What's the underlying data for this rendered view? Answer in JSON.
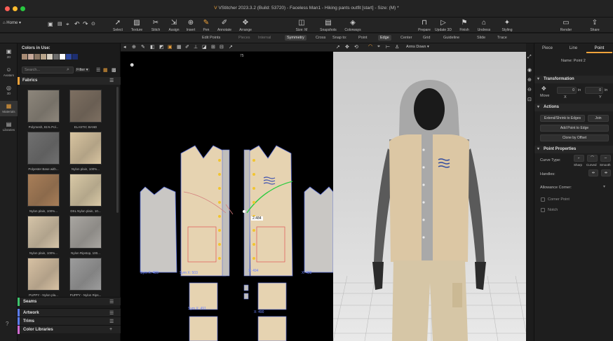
{
  "window": {
    "title": "VStitcher 2023.3.2 (Build: 53720) - Faceless Man1 - Hiking pants outfit [start] - Size: (M) *"
  },
  "nav": {
    "home_label": "Home"
  },
  "toolbar": {
    "tools": [
      {
        "label": "Select",
        "icon": "cursor-icon"
      },
      {
        "label": "Texture",
        "icon": "texture-icon"
      },
      {
        "label": "Stitch",
        "icon": "stitch-icon"
      },
      {
        "label": "Assign",
        "icon": "assign-icon"
      },
      {
        "label": "Insert",
        "icon": "insert-icon"
      },
      {
        "label": "Pen",
        "icon": "pen-icon"
      },
      {
        "label": "Annotate",
        "icon": "annotate-icon"
      },
      {
        "label": "Arrange",
        "icon": "arrange-icon"
      },
      {
        "label": "Size: M",
        "icon": "size-icon"
      },
      {
        "label": "Snapshots",
        "icon": "snapshots-icon"
      },
      {
        "label": "Colorways",
        "icon": "colorways-icon"
      },
      {
        "label": "Prepare",
        "icon": "prepare-icon"
      },
      {
        "label": "Update 3D",
        "icon": "update-3d-icon"
      },
      {
        "label": "Finish",
        "icon": "finish-icon"
      },
      {
        "label": "Undress",
        "icon": "undress-icon"
      },
      {
        "label": "Styling",
        "icon": "styling-icon"
      },
      {
        "label": "Render",
        "icon": "render-icon"
      },
      {
        "label": "Share",
        "icon": "share-icon"
      }
    ],
    "active_tool": "Pen"
  },
  "subbar": {
    "edit_points": "Edit Points",
    "pieces": "Pieces",
    "internal": "Internal",
    "symmetry": "Symmetry",
    "cross": "Cross",
    "snap_to": "Snap to:",
    "point": "Point",
    "edge": "Edge",
    "center": "Center",
    "grid": "Grid",
    "guideline": "Guideline",
    "slide": "Slide",
    "trace": "Trace"
  },
  "rail": {
    "items": [
      {
        "label": "2D",
        "icon": "pattern-2d-icon"
      },
      {
        "label": "Avatars",
        "icon": "avatar-icon"
      },
      {
        "label": "3D",
        "icon": "view-3d-icon"
      },
      {
        "label": "Materials",
        "icon": "materials-icon"
      },
      {
        "label": "Libraries",
        "icon": "libraries-icon"
      }
    ],
    "active": "Materials"
  },
  "library": {
    "colors_in_use": "Colors in Use:",
    "swatches": [
      "#a88b74",
      "#c7a99a",
      "#8a7664",
      "#b8a48a",
      "#d8d0c2",
      "#6c6c6c",
      "#ffffff",
      "#2f4aa0",
      "#1d2e70"
    ],
    "search_placeholder": "Search...",
    "filter_label": "Filter",
    "fabrics_title": "Fabrics",
    "fabrics": [
      {
        "label": "Polymesh, 81% Pol...",
        "color": "#8d867b"
      },
      {
        "label": "ELASTIC BAND",
        "color": "#7d6f61"
      },
      {
        "label": "Polyester Base with...",
        "color": "#707070"
      },
      {
        "label": "Nylon plain, 100%...",
        "color": "#d8c4a0"
      },
      {
        "label": "Nylon plain, 100%...",
        "color": "#a87e58"
      },
      {
        "label": "DSL Nylon plain, 10...",
        "color": "#d9c9a6"
      },
      {
        "label": "Nylon plain, 100%...",
        "color": "#d5c4a8"
      },
      {
        "label": "Nylon Ripstop, 100...",
        "color": "#a9a6a1"
      },
      {
        "label": "PUPPY - Nylon pla...",
        "color": "#d7c1a3"
      },
      {
        "label": "PUPPY - Nylon Rips...",
        "color": "#9c9c9c"
      }
    ],
    "bottom_sections": [
      "Seams",
      "Artwork",
      "Trims",
      "Color Libraries"
    ]
  },
  "view2d": {
    "ruler_mark": "75",
    "length_label": "2.484",
    "sym_labels": [
      "Sym X: 489",
      "Sym X: 503",
      "X: 494",
      "X: 488",
      "Sym X: 491",
      "X: 490"
    ]
  },
  "view3d": {
    "pose": "Arms Down"
  },
  "props": {
    "tabs": [
      "Piece",
      "Line",
      "Point"
    ],
    "active_tab": "Point",
    "name_label": "Name: Point 2",
    "transformation": "Transformation",
    "move_label": "Move",
    "x_value": "0",
    "y_value": "0",
    "unit": "in",
    "x_label": "X",
    "y_label": "Y",
    "actions": "Actions",
    "extend_btn": "Extend/Shrink to Edges",
    "join_btn": "Join",
    "add_point_btn": "Add Point to Edge",
    "clone_btn": "Clone by Offset",
    "point_props": "Point Properties",
    "curve_type": "Curve Type:",
    "sharp": "Sharp",
    "curved": "Curved",
    "smooth": "Smooth",
    "handles": "Handles:",
    "allowance_corner": "Allowance Corner:",
    "corner_point": "Corner Point",
    "notch": "Notch"
  }
}
